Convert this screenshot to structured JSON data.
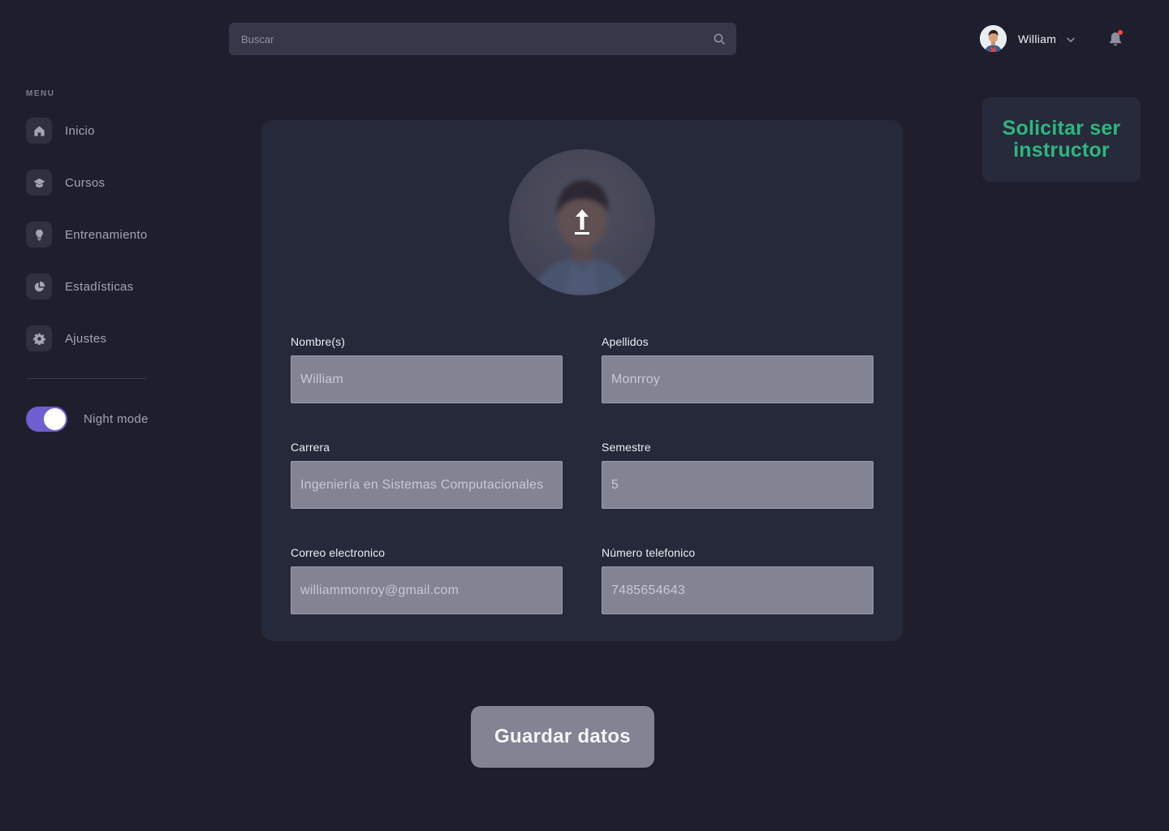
{
  "search": {
    "placeholder": "Buscar"
  },
  "user": {
    "name": "William"
  },
  "sidebar": {
    "heading": "MENU",
    "items": [
      {
        "label": "Inicio",
        "icon": "home-icon"
      },
      {
        "label": "Cursos",
        "icon": "graduation-cap-icon"
      },
      {
        "label": "Entrenamiento",
        "icon": "lightbulb-icon"
      },
      {
        "label": "Estadísticas",
        "icon": "pie-chart-icon"
      },
      {
        "label": "Ajustes",
        "icon": "gear-icon"
      }
    ],
    "night_mode": {
      "label": "Night mode",
      "enabled": true
    }
  },
  "instructor": {
    "label": "Solicitar ser instructor"
  },
  "profile": {
    "fields": {
      "nombre": {
        "label": "Nombre(s)",
        "value": "William"
      },
      "apellidos": {
        "label": "Apellidos",
        "value": "Monrroy"
      },
      "carrera": {
        "label": "Carrera",
        "value": "Ingeniería en Sistemas Computacionales"
      },
      "semestre": {
        "label": "Semestre",
        "value": "5"
      },
      "correo": {
        "label": "Correo electronico",
        "value": "williammonroy@gmail.com"
      },
      "telefono": {
        "label": "Número telefonico",
        "value": "7485654643"
      }
    }
  },
  "actions": {
    "save_label": "Guardar datos"
  },
  "colors": {
    "background": "#1f1e2d",
    "card": "#262939",
    "accent_green": "#2fb67f",
    "toggle": "#6e5fd1",
    "input_fill": "#828393",
    "notification_dot": "#f04a3c"
  }
}
